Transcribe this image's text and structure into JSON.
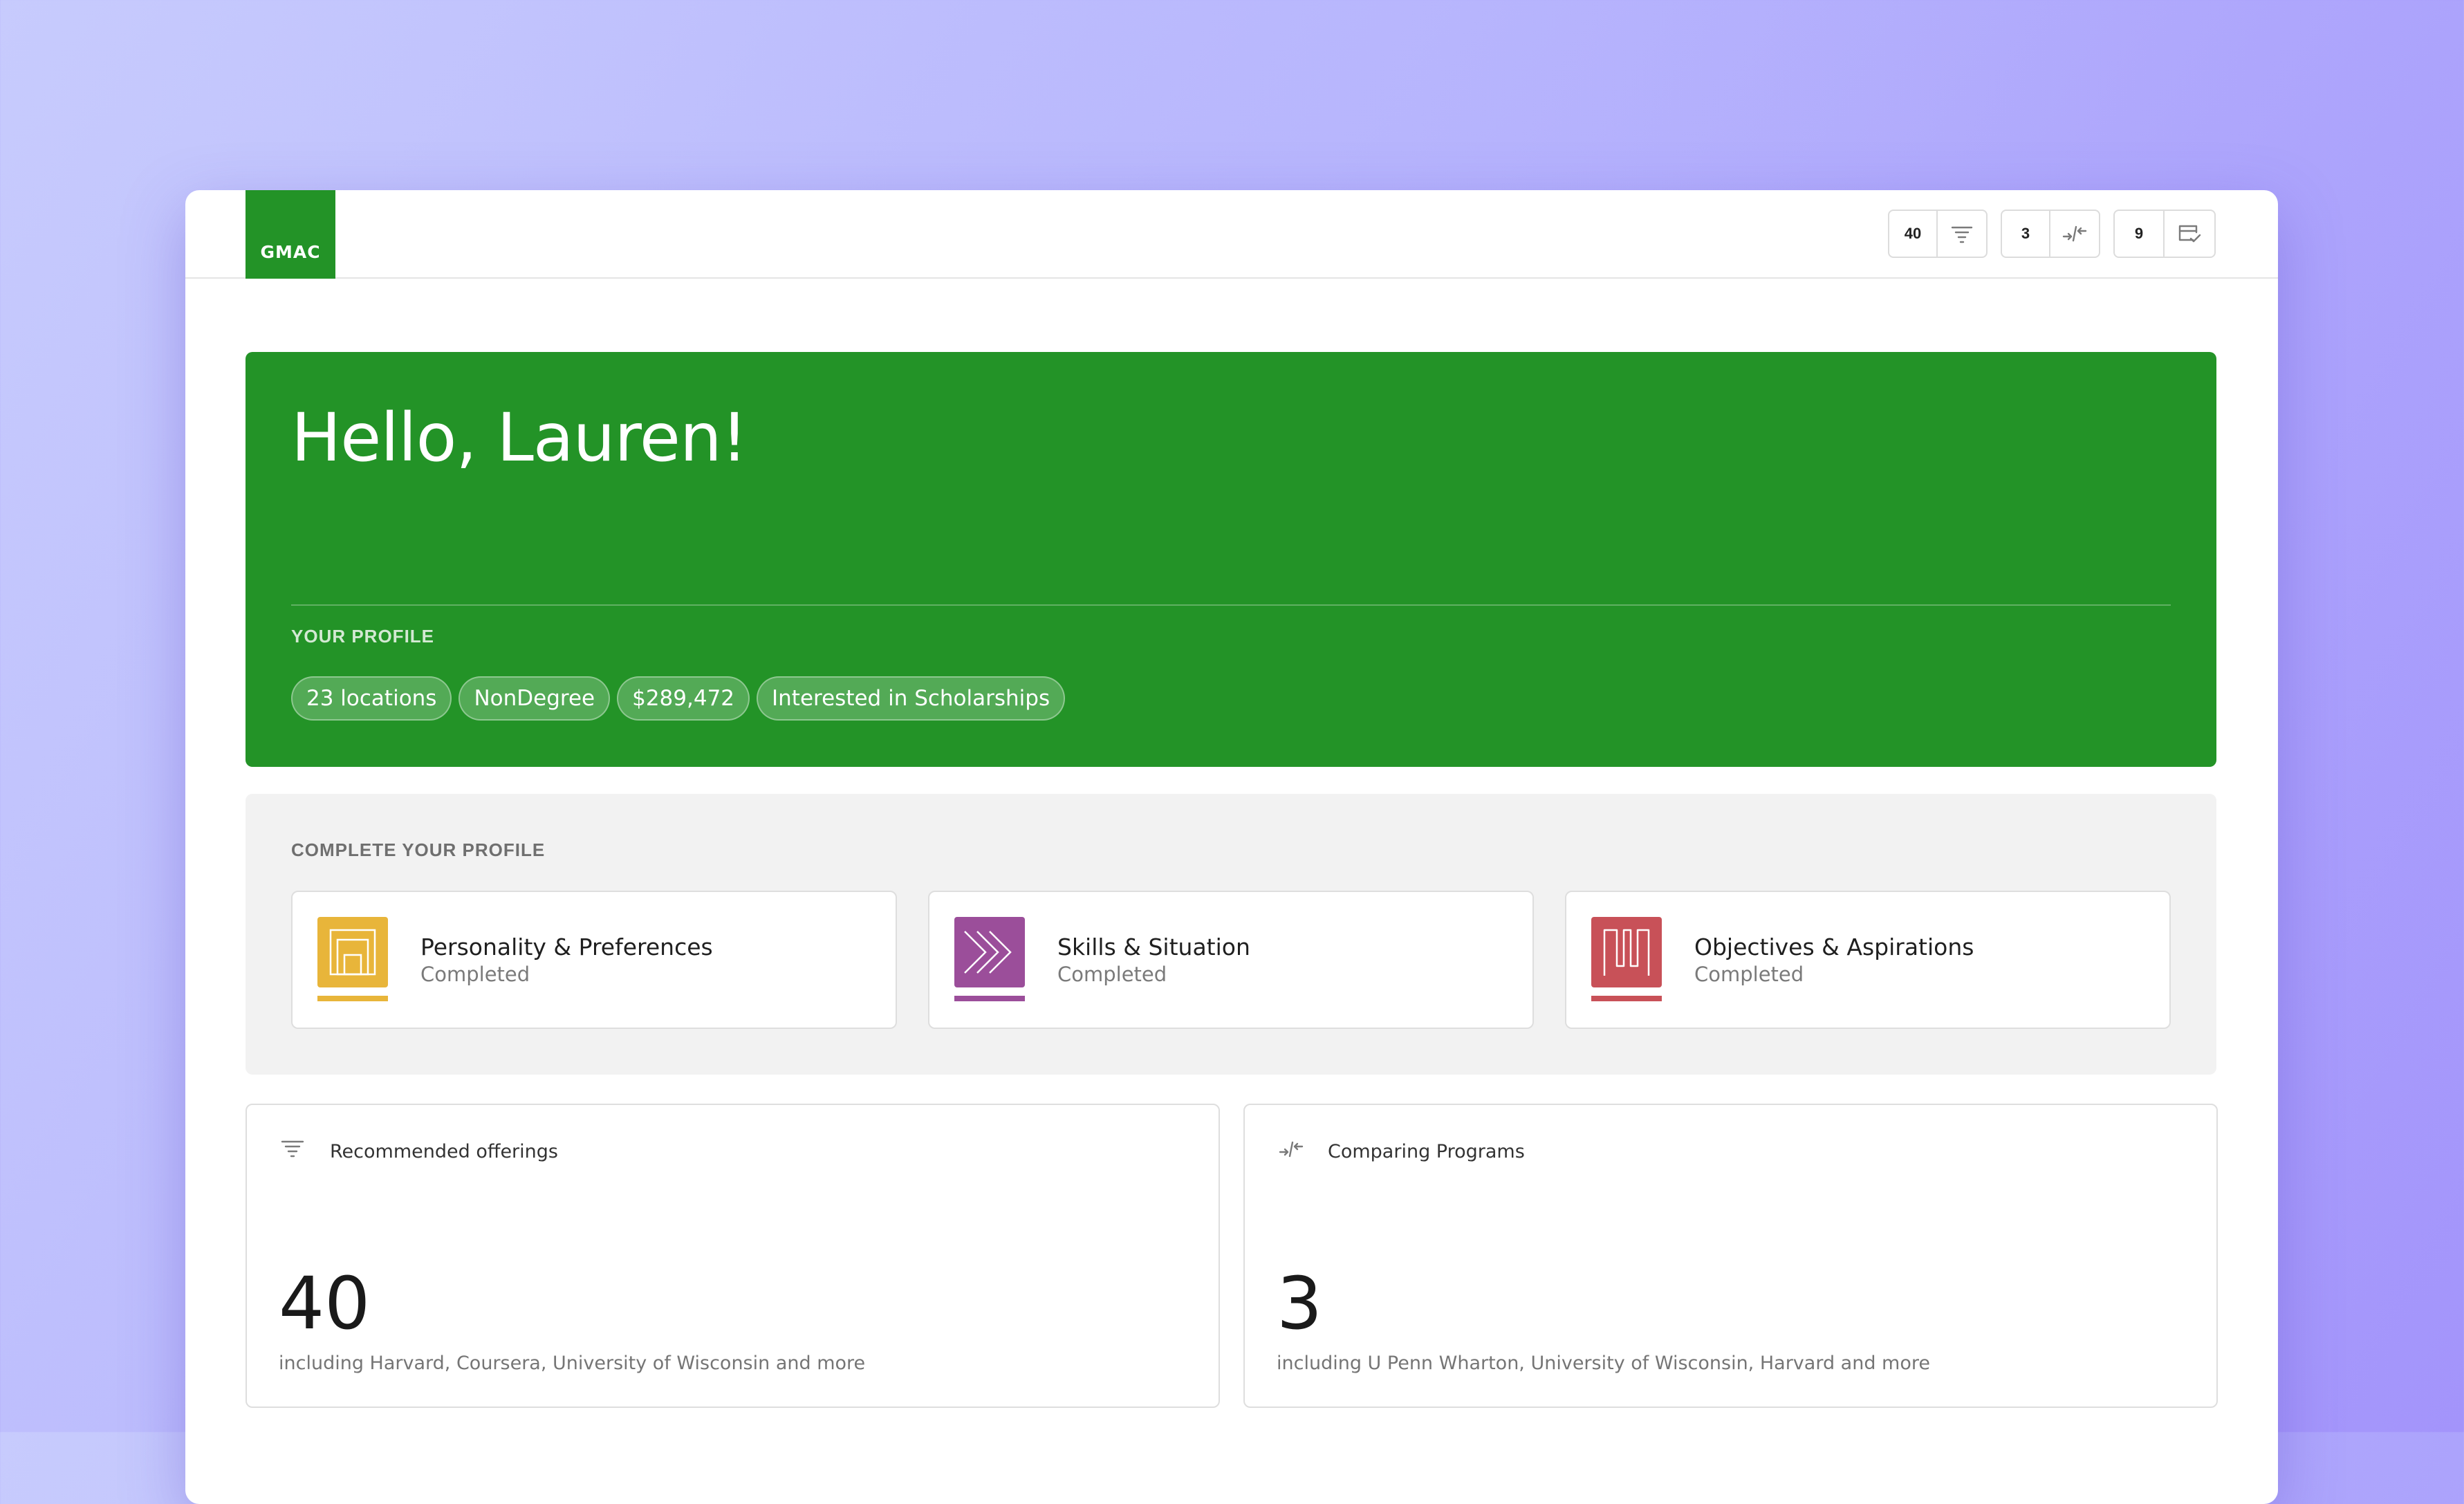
{
  "header": {
    "logo_text": "GMAC",
    "counters": [
      {
        "value": "40",
        "icon": "filter-icon"
      },
      {
        "value": "3",
        "icon": "compare-icon"
      },
      {
        "value": "9",
        "icon": "checklist-icon"
      }
    ]
  },
  "hero": {
    "greeting": "Hello, Lauren!",
    "profile_label": "YOUR PROFILE",
    "chips": [
      "23 locations",
      "NonDegree",
      "$289,472",
      "Interested in Scholarships"
    ],
    "color": "#239327"
  },
  "complete_profile": {
    "label": "COMPLETE YOUR PROFILE",
    "cards": [
      {
        "title": "Personality & Preferences",
        "status": "Completed",
        "icon": "building-icon",
        "color": "#e8b53a"
      },
      {
        "title": "Skills & Situation",
        "status": "Completed",
        "icon": "chevrons-icon",
        "color": "#9b4e9a"
      },
      {
        "title": "Objectives & Aspirations",
        "status": "Completed",
        "icon": "zigzag-icon",
        "color": "#c85158"
      }
    ]
  },
  "stats": [
    {
      "title": "Recommended offerings",
      "value": "40",
      "description": "including Harvard, Coursera, University of Wisconsin and more",
      "icon": "filter-icon"
    },
    {
      "title": "Comparing Programs",
      "value": "3",
      "description": "including U Penn Wharton, University of Wisconsin, Harvard and more",
      "icon": "compare-icon"
    }
  ]
}
